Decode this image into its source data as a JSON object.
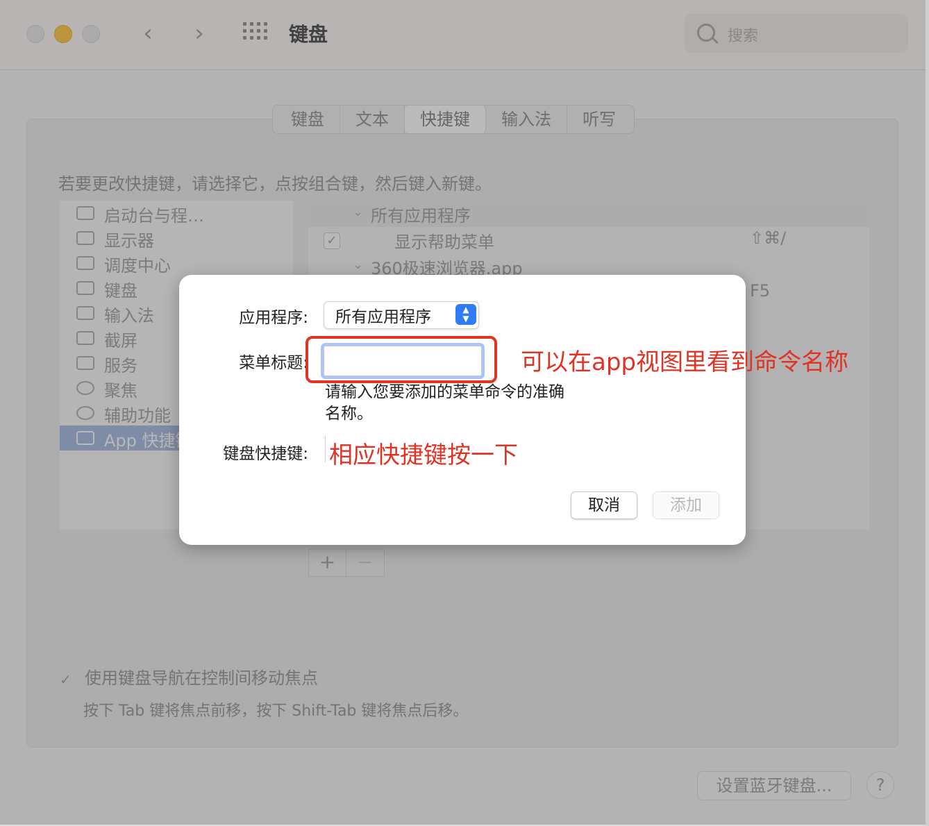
{
  "window": {
    "title": "键盘",
    "search_placeholder": "搜索",
    "back_glyph": "‹",
    "forward_glyph": "›"
  },
  "tabs": [
    {
      "label": "键盘",
      "active": false
    },
    {
      "label": "文本",
      "active": false
    },
    {
      "label": "快捷键",
      "active": true
    },
    {
      "label": "输入法",
      "active": false
    },
    {
      "label": "听写",
      "active": false
    }
  ],
  "instruction": "若要更改快捷键，请选择它，点按组合键，然后键入新键。",
  "categories": [
    {
      "label": "启动台与程…",
      "icon": "launchpad-icon"
    },
    {
      "label": "显示器",
      "icon": "display-icon"
    },
    {
      "label": "调度中心",
      "icon": "mission-control-icon"
    },
    {
      "label": "键盘",
      "icon": "keyboard-icon"
    },
    {
      "label": "输入法",
      "icon": "input-method-icon"
    },
    {
      "label": "截屏",
      "icon": "screenshot-icon"
    },
    {
      "label": "服务",
      "icon": "services-gear-icon"
    },
    {
      "label": "聚焦",
      "icon": "spotlight-icon"
    },
    {
      "label": "辅助功能",
      "icon": "accessibility-icon"
    },
    {
      "label": "App 快捷键",
      "icon": "app-store-icon",
      "selected": true
    }
  ],
  "shortcuts": {
    "group1": "所有应用程序",
    "item1_label": "显示帮助菜单",
    "item1_key": "⇧⌘/",
    "group2": "360极速浏览器.app",
    "item2_key": "F5"
  },
  "add_remove": {
    "plus": "+",
    "minus": "−"
  },
  "keyboard_nav": {
    "label": "使用键盘导航在控制间移动焦点",
    "checked": true,
    "note": "按下 Tab 键将焦点前移，按下 Shift-Tab 键将焦点后移。"
  },
  "bottom": {
    "bluetooth_button": "设置蓝牙键盘...",
    "help_button": "?"
  },
  "dialog": {
    "app_label": "应用程序:",
    "app_value": "所有应用程序",
    "menu_title_label": "菜单标题:",
    "menu_title_value": "",
    "hint": "请输入您要添加的菜单命令的准确名称。",
    "shortcut_label": "键盘快捷键:",
    "cancel_label": "取消",
    "add_label": "添加",
    "annotation_menu_title": "可以在app视图里看到命令名称",
    "annotation_shortcut": "相应快捷键按一下"
  },
  "colors": {
    "accent": "#2f7cf6",
    "annotation_red": "#e03324",
    "selection": "#9fb3d7",
    "minimize_yellow": "#f6c03b"
  }
}
